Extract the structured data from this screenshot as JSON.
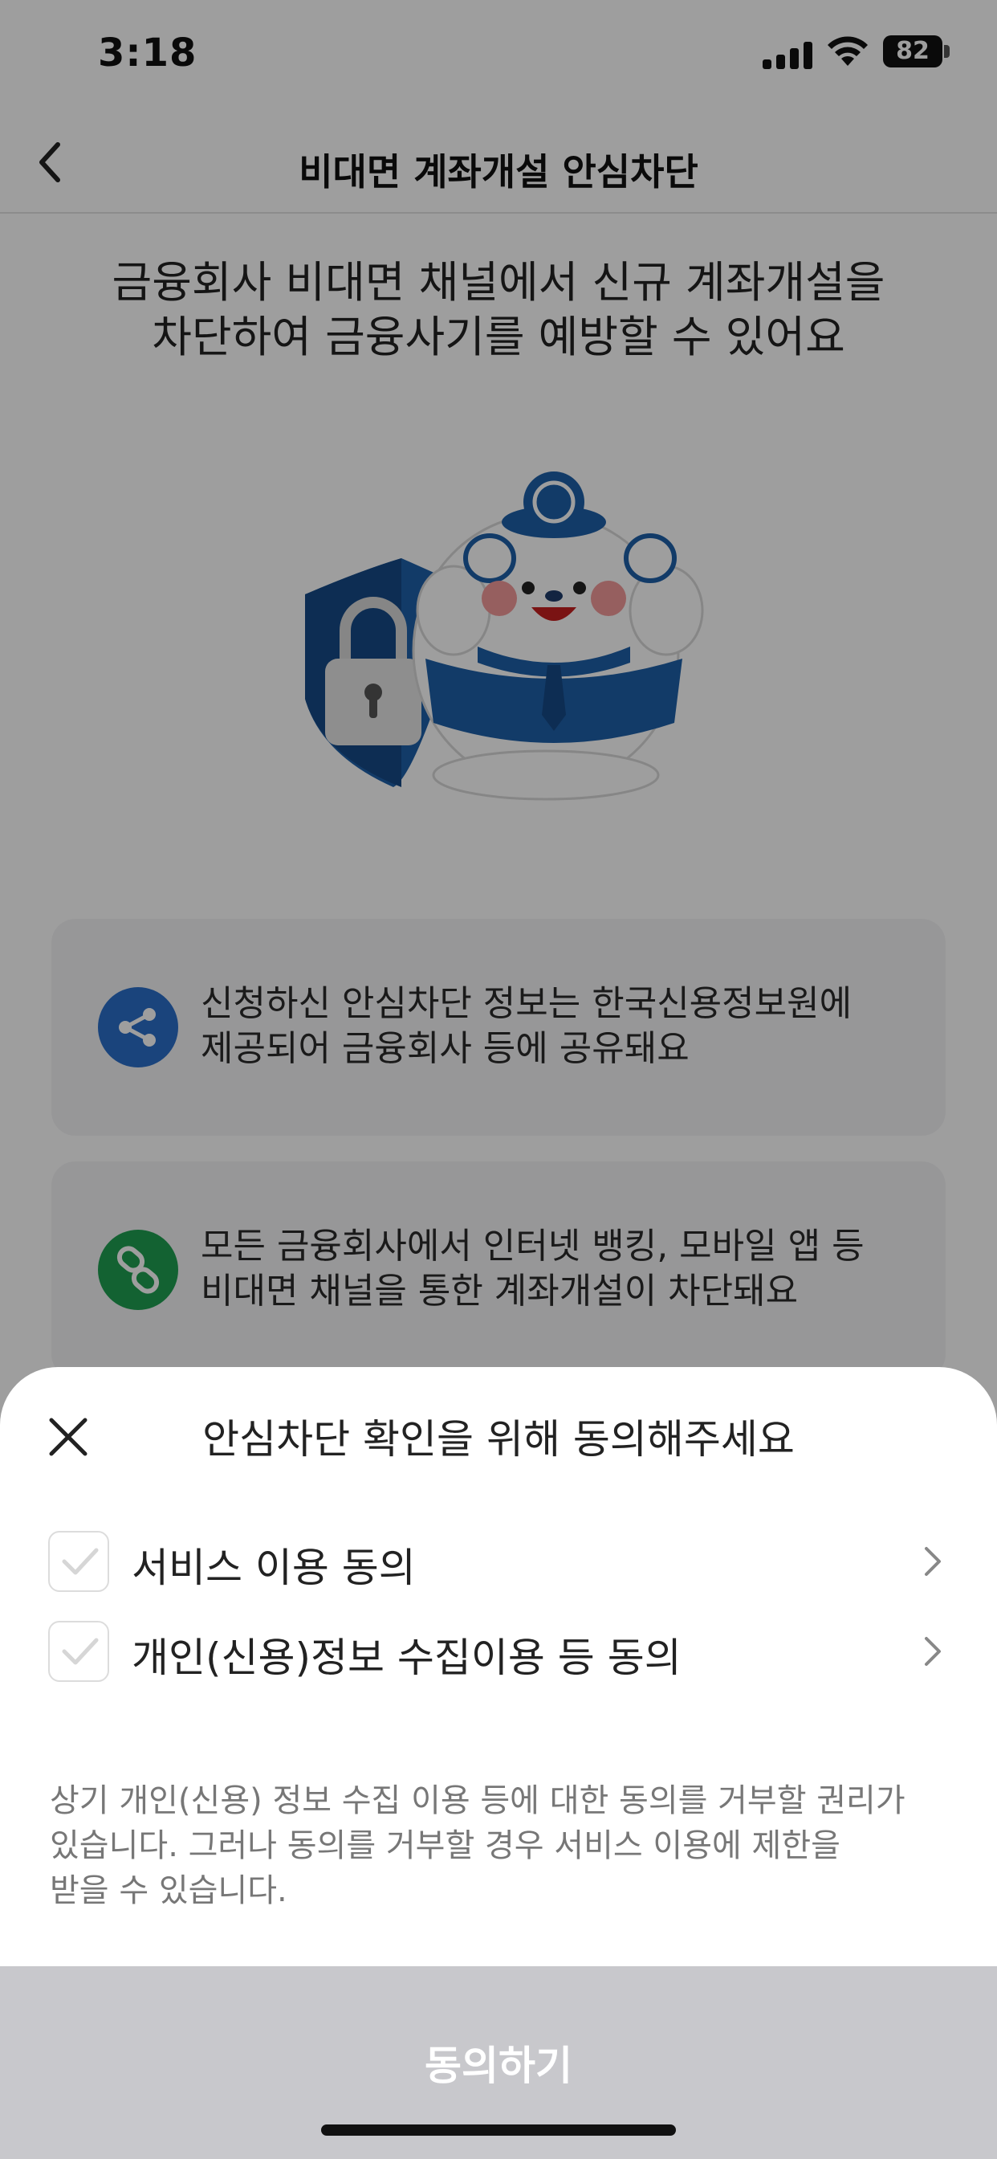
{
  "status_bar": {
    "time": "3:18",
    "battery": "82"
  },
  "header": {
    "title": "비대면 계좌개설 안심차단"
  },
  "hero": {
    "headline_line1": "금융회사 비대면 채널에서 신규 계좌개설을",
    "headline_line2": "차단하여 금융사기를 예방할 수 있어요"
  },
  "cards": [
    {
      "icon": "share-icon",
      "line1": "신청하신 안심차단 정보는 한국신용정보원에",
      "line2": "제공되어 금융회사 등에 공유돼요"
    },
    {
      "icon": "link-icon",
      "line1": "모든 금융회사에서 인터넷 뱅킹, 모바일 앱 등",
      "line2": "비대면 채널을 통한 계좌개설이 차단돼요"
    }
  ],
  "sheet": {
    "title": "안심차단 확인을 위해 동의해주세요",
    "agreements": [
      {
        "label": "서비스 이용 동의",
        "checked": false
      },
      {
        "label": "개인(신용)정보 수집이용 등 동의",
        "checked": false
      }
    ],
    "notice_line1": "상기 개인(신용) 정보 수집 이용 등에 대한 동의를 거부할 권리가",
    "notice_line2": "있습니다. 그러나 동의를 거부할 경우 서비스 이용에 제한을",
    "notice_line3": "받을 수 있습니다.",
    "confirm_label": "동의하기"
  },
  "colors": {
    "brand_blue": "#1e5fa8",
    "button_disabled": "#c8c8cc",
    "overlay": "rgba(0,0,0,0.38)"
  }
}
